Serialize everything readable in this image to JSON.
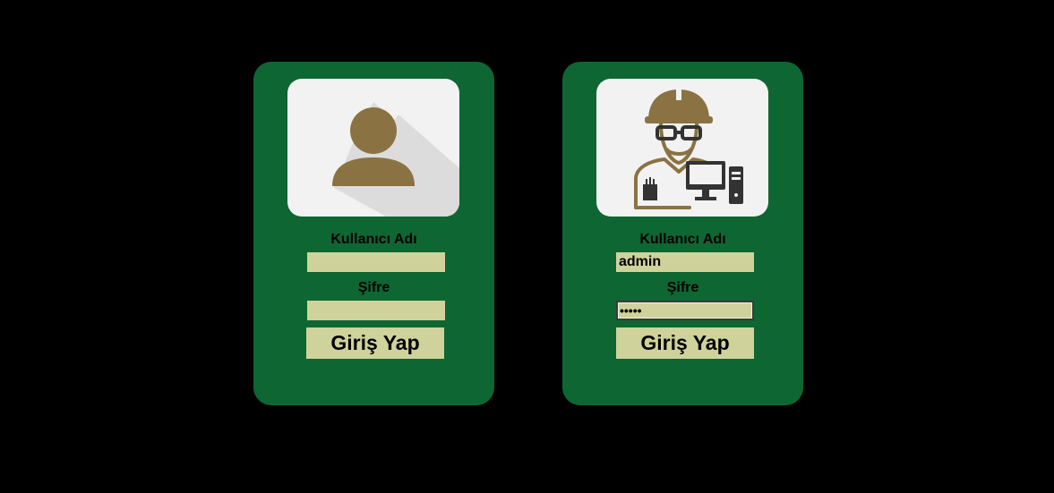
{
  "cards": [
    {
      "avatar": "user-silhouette-icon",
      "username_label": "Kullanıcı Adı",
      "username_value": "",
      "password_label": "Şifre",
      "password_value": "",
      "login_label": "Giriş Yap"
    },
    {
      "avatar": "engineer-computer-icon",
      "username_label": "Kullanıcı Adı",
      "username_value": "admin",
      "password_label": "Şifre",
      "password_value": "•••••",
      "login_label": "Giriş Yap"
    }
  ],
  "colors": {
    "background": "#000000",
    "card": "#0e6633",
    "field": "#cfd39b",
    "avatar_bg": "#f2f2f2",
    "icon_brown": "#8b7242"
  }
}
